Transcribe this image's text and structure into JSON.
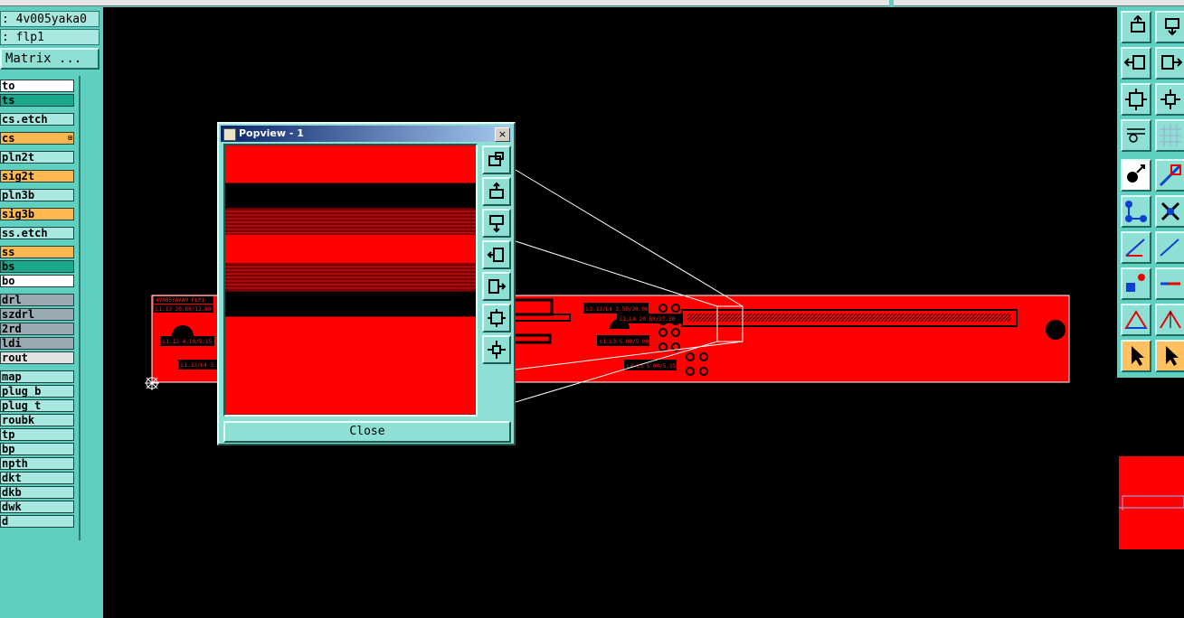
{
  "info": {
    "design": ": 4v005yaka0",
    "symbol": ": flp1",
    "matrix_button": "Matrix ..."
  },
  "layers": [
    {
      "label": "to",
      "color": "#ffffff"
    },
    {
      "label": "ts",
      "color": "#1aa88a"
    },
    {
      "label": "cs.etch",
      "color": "#a8e8e0"
    },
    {
      "label": "cs",
      "color": "#ffb850",
      "mark": "⊞"
    },
    {
      "label": "pln2t",
      "color": "#a8e8e0"
    },
    {
      "label": "sig2t",
      "color": "#ffb850"
    },
    {
      "label": "pln3b",
      "color": "#a8e8e0"
    },
    {
      "label": "sig3b",
      "color": "#ffb850"
    },
    {
      "label": "ss.etch",
      "color": "#a8e8e0"
    },
    {
      "label": "ss",
      "color": "#ffb850"
    },
    {
      "label": "bs",
      "color": "#1aa88a"
    },
    {
      "label": "bo",
      "color": "#ffffff"
    },
    {
      "label": "drl",
      "color": "#9aaab2"
    },
    {
      "label": "szdrl",
      "color": "#9aaab2"
    },
    {
      "label": "2rd",
      "color": "#9aaab2"
    },
    {
      "label": "ldi",
      "color": "#9aaab2"
    },
    {
      "label": "rout",
      "color": "#e2e2e2"
    },
    {
      "label": "map",
      "color": "#a8e8e0"
    },
    {
      "label": "plug_b",
      "color": "#a8e8e0"
    },
    {
      "label": "plug_t",
      "color": "#a8e8e0"
    },
    {
      "label": "roubk",
      "color": "#a8e8e0"
    },
    {
      "label": "tp",
      "color": "#a8e8e0"
    },
    {
      "label": "bp",
      "color": "#a8e8e0"
    },
    {
      "label": "npth",
      "color": "#a8e8e0"
    },
    {
      "label": "dkt",
      "color": "#a8e8e0"
    },
    {
      "label": "dkb",
      "color": "#a8e8e0"
    },
    {
      "label": "dwk",
      "color": "#a8e8e0"
    },
    {
      "label": "d",
      "color": "#a8e8e0"
    }
  ],
  "board": {
    "title": "4V005YAKA0 FLP1",
    "labels": [
      "L1.13 20.80/12.80",
      "L1.12 4.10/5.15",
      "L1.13/L4 3.",
      "L3.13/L4 3.50/30.00",
      "L1.L4 20.80/27.30",
      "L1.L3 5.00/5.00",
      "L4.L3 5.00/5.15"
    ]
  },
  "popup": {
    "title": "Popview - 1",
    "close_label": "Close",
    "close_x": "×"
  },
  "toolbar": {
    "icons": [
      "move-up-icon",
      "move-down-icon",
      "move-left-icon",
      "move-right-icon",
      "fit-icon",
      "center-icon",
      "settings-icon",
      "grid-icon",
      "select-pad-icon",
      "route-icon",
      "connect-icon",
      "delete-icon",
      "line-icon",
      "line-2-icon",
      "pad-icon",
      "trace-icon",
      "measure-icon",
      "measure-2-icon",
      "pointer-icon",
      "pointer-2-icon"
    ]
  },
  "colors": {
    "panel": "#5fcfc0",
    "board": "#ff0000",
    "canvas": "#000000"
  }
}
